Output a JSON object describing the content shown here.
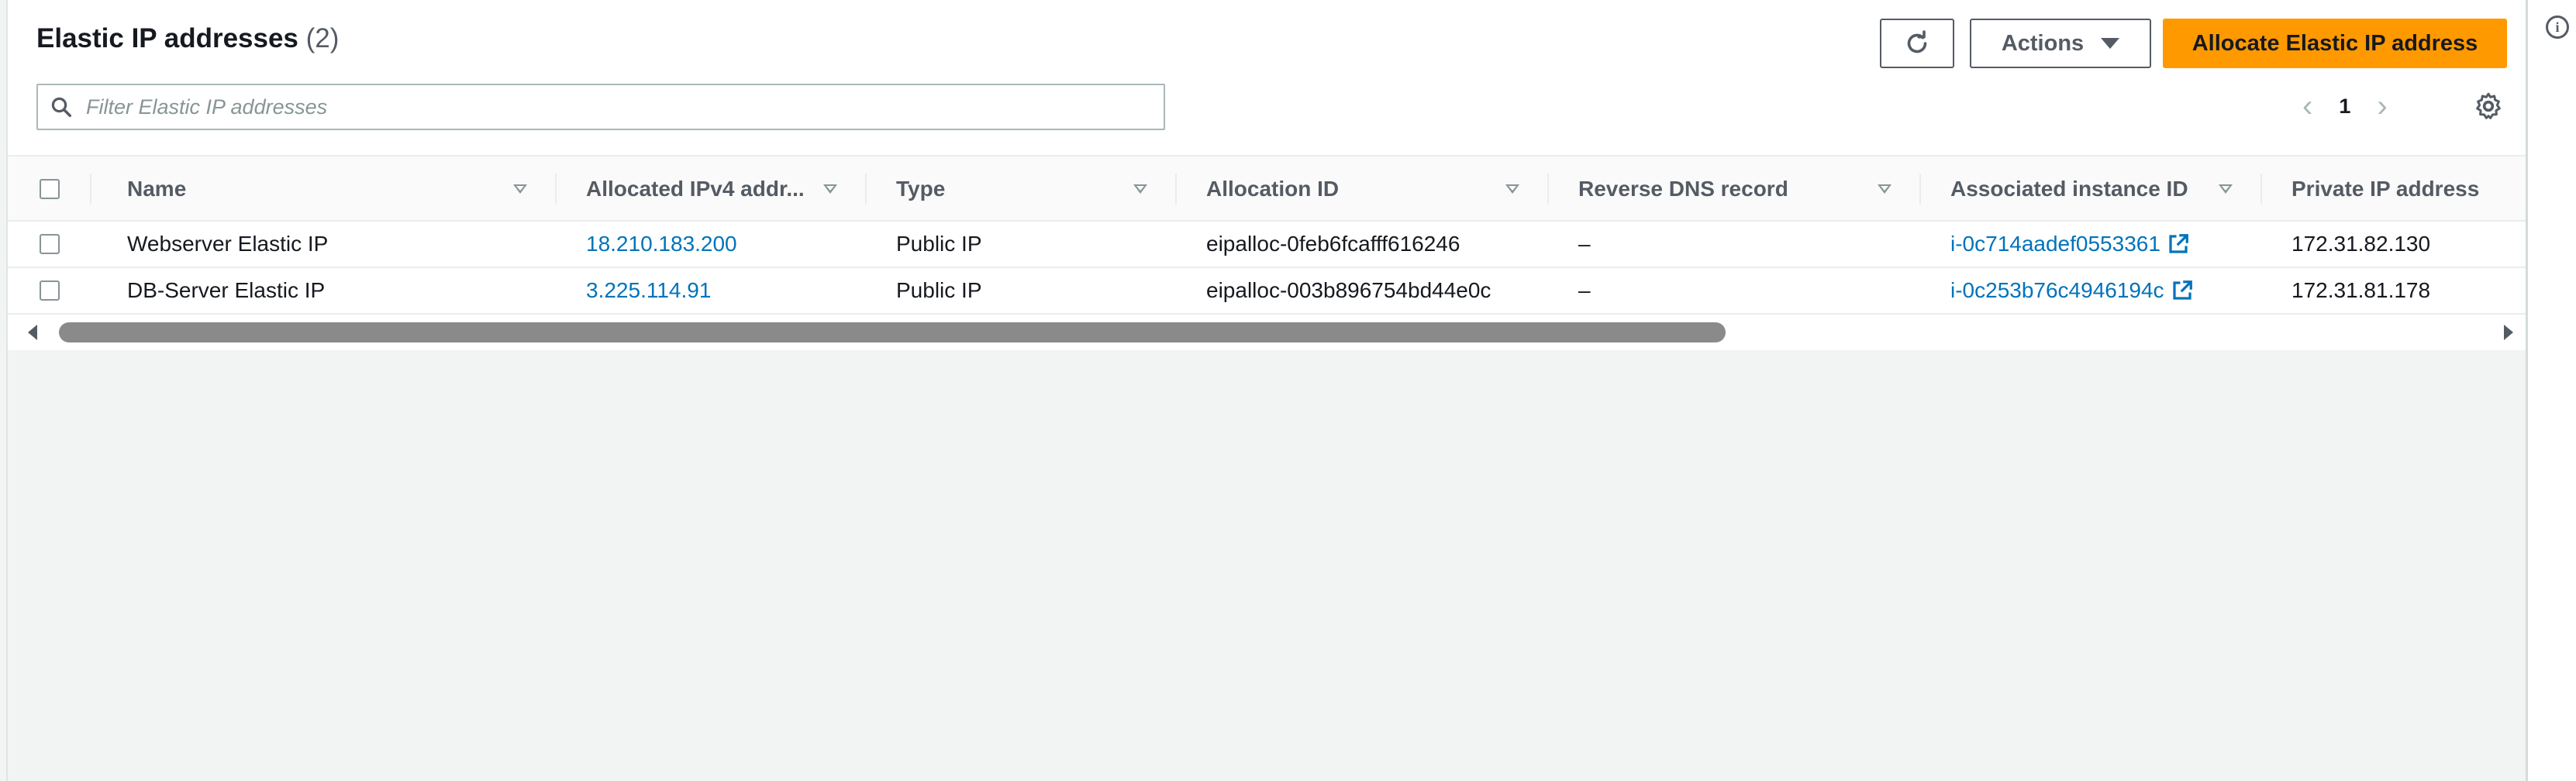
{
  "header": {
    "title": "Elastic IP addresses",
    "count": "(2)",
    "actions_label": "Actions",
    "allocate_label": "Allocate Elastic IP address",
    "refresh_icon": "refresh-icon",
    "actions_caret_icon": "caret-down-icon"
  },
  "search": {
    "placeholder": "Filter Elastic IP addresses",
    "value": ""
  },
  "pagination": {
    "current_page": "1"
  },
  "table": {
    "columns": [
      "Name",
      "Allocated IPv4 addr...",
      "Type",
      "Allocation ID",
      "Reverse DNS record",
      "Associated instance ID",
      "Private IP address"
    ],
    "rows": [
      {
        "name": "Webserver Elastic IP",
        "ipv4": "18.210.183.200",
        "type": "Public IP",
        "allocation_id": "eipalloc-0feb6fcafff616246",
        "reverse_dns": "–",
        "instance_id": "i-0c714aadef0553361",
        "private_ip": "172.31.82.130"
      },
      {
        "name": "DB-Server Elastic IP",
        "ipv4": "3.225.114.91",
        "type": "Public IP",
        "allocation_id": "eipalloc-003b896754bd44e0c",
        "reverse_dns": "–",
        "instance_id": "i-0c253b76c4946194c",
        "private_ip": "172.31.81.178"
      }
    ]
  },
  "colors": {
    "primary_button": "#ff9900",
    "link": "#0073bb",
    "text": "#16191f",
    "muted": "#545b64"
  }
}
